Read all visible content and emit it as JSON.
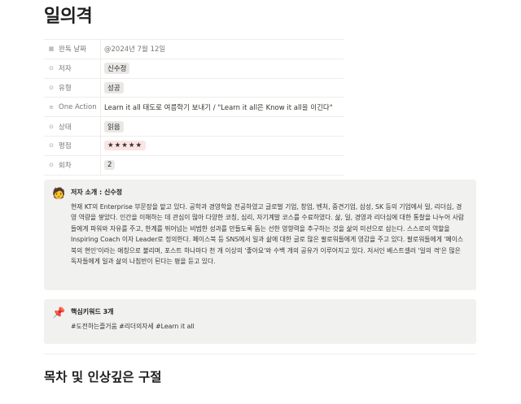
{
  "page": {
    "title": "일의격"
  },
  "properties": [
    {
      "icon": "calendar-icon",
      "glyph": "▦",
      "name": "완독 날짜",
      "value": "@2024년 7월 12일",
      "kind": "date"
    },
    {
      "icon": "select-icon",
      "glyph": "⊙",
      "name": "저자",
      "value": "신수정",
      "kind": "tag"
    },
    {
      "icon": "select-icon",
      "glyph": "⊙",
      "name": "유형",
      "value": "성공",
      "kind": "tag"
    },
    {
      "icon": "text-icon",
      "glyph": "≡",
      "name": "One Action",
      "value": "Learn it all 태도로 여름학기 보내기 / \"Learn it all은 Know it all을 이긴다\"",
      "kind": "text"
    },
    {
      "icon": "select-icon",
      "glyph": "⊙",
      "name": "상태",
      "value": "읽음",
      "kind": "tag"
    },
    {
      "icon": "select-icon",
      "glyph": "⊙",
      "name": "평점",
      "value": "★★★★★",
      "kind": "tag-red"
    },
    {
      "icon": "select-icon",
      "glyph": "⊙",
      "name": "회차",
      "value": "2",
      "kind": "tag"
    }
  ],
  "author_callout": {
    "icon": "🧑",
    "title": "저자 소개 : 신수정",
    "body": "현재 KT의 Enterprise 부문장을 맡고 있다. 공학과 경영학을 전공하였고 글로벌 기업, 창업, 벤처, 중견기업, 삼성, SK 등의 기업에서 일, 리더십, 경영 역량을 쌓았다. 인간을 이해하는 데 관심이 많아 다양한 코칭, 심리, 자기계발 코스를 수료하였다. 삶, 일, 경영과 리더십에 대한 통찰을 나누어 사람들에게 파워와 자유를 주고, 한계를 뛰어넘는 비범한 성과를 만들도록 돕는 선한 영향력을 추구하는 것을 삶의 미션으로 삼는다. 스스로의 역할을 Inspiring Coach 이자 Leader로 정의한다. 페이스북 등 SNS에서 일과 삶에 대한 글로 많은 팔로워들에게 영감을 주고 있다. 팔로워들에게 '페이스북의 현인'이라는 애칭으로 불리며, 포스트 하나마다 천 개 이상의 '좋아요'와 수백 개의 공유가 이루어지고 있다. 저서인 베스트셀러 '일의 격'은 많은 독자들에게 일과 삶의 나침반이 된다는 평을 듣고 있다."
  },
  "keyword_callout": {
    "icon": "📌",
    "title": "핵심키워드 3개",
    "body": "#도전하는즐거움 #리더의자세 #Learn it all"
  },
  "section_heading": "목차 및 인상깊은 구절"
}
